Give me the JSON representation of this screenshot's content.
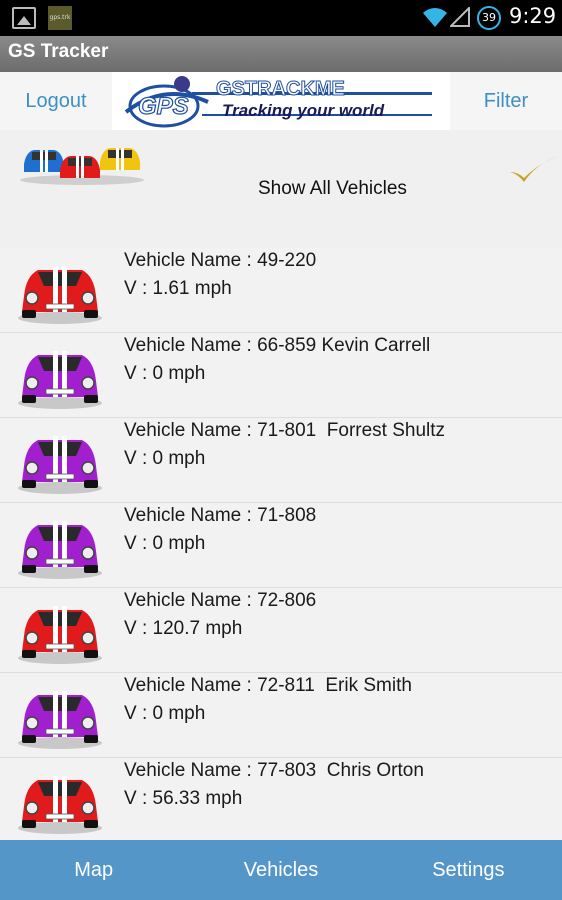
{
  "status_bar": {
    "time": "9:29",
    "battery_level": "39",
    "notification_app_label": "gps.trk"
  },
  "app_title": "GS Tracker",
  "header": {
    "logout_label": "Logout",
    "filter_label": "Filter",
    "logo": {
      "badge": "GPS",
      "brand": "GSTRACKME",
      "tagline": "Tracking your world"
    }
  },
  "show_all": {
    "label": "Show All Vehicles",
    "checked": true
  },
  "vehicles": [
    {
      "name": "Vehicle Name : 49-220",
      "speed": "V : 1.61 mph",
      "car_color": "#e11b1b"
    },
    {
      "name": "Vehicle Name : 66-859 Kevin Carrell",
      "speed": "V : 0 mph",
      "car_color": "#a21fd0"
    },
    {
      "name": "Vehicle Name : 71-801  Forrest Shultz",
      "speed": "V : 0 mph",
      "car_color": "#a21fd0"
    },
    {
      "name": "Vehicle Name : 71-808",
      "speed": "V : 0 mph",
      "car_color": "#a21fd0"
    },
    {
      "name": "Vehicle Name : 72-806",
      "speed": "V : 120.7 mph",
      "car_color": "#e11b1b"
    },
    {
      "name": "Vehicle Name : 72-811  Erik Smith",
      "speed": "V : 0 mph",
      "car_color": "#a21fd0"
    },
    {
      "name": "Vehicle Name : 77-803  Chris Orton",
      "speed": "V : 56.33 mph",
      "car_color": "#e11b1b"
    }
  ],
  "bottom_nav": [
    {
      "label": "Map"
    },
    {
      "label": "Vehicles"
    },
    {
      "label": "Settings"
    }
  ],
  "colors": {
    "link_blue": "#3e8fc3",
    "bottom_bar": "#5596c8",
    "check_gold": "#c9a227"
  }
}
